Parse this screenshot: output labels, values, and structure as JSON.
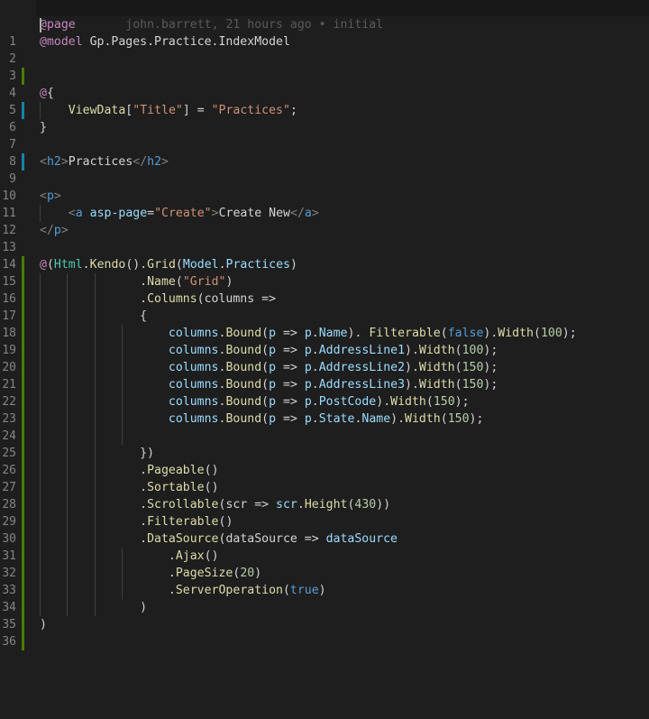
{
  "blame": "john.barrett, 21 hours ago • initial",
  "lines": [
    {
      "n": "1",
      "diff": "none",
      "cursor": true,
      "tokens": [
        [
          "kw",
          "@"
        ],
        [
          "kw",
          "page"
        ]
      ]
    },
    {
      "n": "2",
      "diff": "none",
      "tokens": [
        [
          "kw",
          "@model"
        ],
        [
          "pl",
          " Gp.Pages.Practice.IndexModel"
        ]
      ]
    },
    {
      "n": "3",
      "diff": "none",
      "tokens": []
    },
    {
      "n": "4",
      "diff": "add",
      "tokens": []
    },
    {
      "n": "5",
      "diff": "none",
      "tokens": [
        [
          "kw",
          "@"
        ],
        [
          "pl",
          "{"
        ]
      ]
    },
    {
      "n": "6",
      "diff": "mod",
      "guides": [
        1
      ],
      "tokens": [
        [
          "pl",
          "    "
        ],
        [
          "fn",
          "ViewData"
        ],
        [
          "pl",
          "["
        ],
        [
          "str",
          "\"Title\""
        ],
        [
          "pl",
          "] = "
        ],
        [
          "str",
          "\"Practices\""
        ],
        [
          "pl",
          ";"
        ]
      ]
    },
    {
      "n": "7",
      "diff": "none",
      "tokens": [
        [
          "pl",
          "}"
        ]
      ]
    },
    {
      "n": "8",
      "diff": "none",
      "tokens": []
    },
    {
      "n": "9",
      "diff": "mod",
      "tokens": [
        [
          "tag",
          "<"
        ],
        [
          "tagn",
          "h2"
        ],
        [
          "tag",
          ">"
        ],
        [
          "pl",
          "Practices"
        ],
        [
          "tag",
          "</"
        ],
        [
          "tagn",
          "h2"
        ],
        [
          "tag",
          ">"
        ]
      ]
    },
    {
      "n": "10",
      "diff": "none",
      "tokens": []
    },
    {
      "n": "11",
      "diff": "none",
      "tokens": [
        [
          "tag",
          "<"
        ],
        [
          "tagn",
          "p"
        ],
        [
          "tag",
          ">"
        ]
      ]
    },
    {
      "n": "12",
      "diff": "none",
      "guides": [
        1
      ],
      "tokens": [
        [
          "pl",
          "    "
        ],
        [
          "tag",
          "<"
        ],
        [
          "tagn",
          "a"
        ],
        [
          "pl",
          " "
        ],
        [
          "attr",
          "asp-page"
        ],
        [
          "pl",
          "="
        ],
        [
          "str",
          "\"Create\""
        ],
        [
          "tag",
          ">"
        ],
        [
          "pl",
          "Create New"
        ],
        [
          "tag",
          "</"
        ],
        [
          "tagn",
          "a"
        ],
        [
          "tag",
          ">"
        ]
      ]
    },
    {
      "n": "13",
      "diff": "none",
      "tokens": [
        [
          "tag",
          "</"
        ],
        [
          "tagn",
          "p"
        ],
        [
          "tag",
          ">"
        ]
      ]
    },
    {
      "n": "14",
      "diff": "none",
      "tokens": []
    },
    {
      "n": "15",
      "diff": "add",
      "tokens": [
        [
          "kw",
          "@"
        ],
        [
          "pl",
          "("
        ],
        [
          "ty",
          "Html"
        ],
        [
          "pl",
          "."
        ],
        [
          "fn",
          "Kendo"
        ],
        [
          "pl",
          "()."
        ],
        [
          "fn",
          "Grid"
        ],
        [
          "pl",
          "("
        ],
        [
          "var",
          "Model"
        ],
        [
          "pl",
          "."
        ],
        [
          "var",
          "Practices"
        ],
        [
          "pl",
          ")"
        ]
      ]
    },
    {
      "n": "16",
      "diff": "add",
      "guides": [
        1,
        2,
        3
      ],
      "tokens": [
        [
          "pl",
          "              ."
        ],
        [
          "fn",
          "Name"
        ],
        [
          "pl",
          "("
        ],
        [
          "str",
          "\"Grid\""
        ],
        [
          "pl",
          ")"
        ]
      ]
    },
    {
      "n": "17",
      "diff": "add",
      "guides": [
        1,
        2,
        3
      ],
      "tokens": [
        [
          "pl",
          "              ."
        ],
        [
          "fn",
          "Columns"
        ],
        [
          "pl",
          "(columns =>"
        ]
      ]
    },
    {
      "n": "18",
      "diff": "add",
      "guides": [
        1,
        2,
        3
      ],
      "tokens": [
        [
          "pl",
          "              {"
        ]
      ]
    },
    {
      "n": "19",
      "diff": "add",
      "guides": [
        1,
        2,
        3,
        4
      ],
      "tokens": [
        [
          "pl",
          "                  "
        ],
        [
          "lv",
          "columns"
        ],
        [
          "pl",
          "."
        ],
        [
          "fn",
          "Bound"
        ],
        [
          "pl",
          "("
        ],
        [
          "lv",
          "p"
        ],
        [
          "pl",
          " => "
        ],
        [
          "lv",
          "p"
        ],
        [
          "pl",
          "."
        ],
        [
          "var",
          "Name"
        ],
        [
          "pl",
          "). "
        ],
        [
          "fn",
          "Filterable"
        ],
        [
          "pl",
          "("
        ],
        [
          "bool",
          "false"
        ],
        [
          "pl",
          ")."
        ],
        [
          "fn",
          "Width"
        ],
        [
          "pl",
          "("
        ],
        [
          "num",
          "100"
        ],
        [
          "pl",
          ");"
        ]
      ]
    },
    {
      "n": "20",
      "diff": "add",
      "guides": [
        1,
        2,
        3,
        4
      ],
      "tokens": [
        [
          "pl",
          "                  "
        ],
        [
          "lv",
          "columns"
        ],
        [
          "pl",
          "."
        ],
        [
          "fn",
          "Bound"
        ],
        [
          "pl",
          "("
        ],
        [
          "lv",
          "p"
        ],
        [
          "pl",
          " => "
        ],
        [
          "lv",
          "p"
        ],
        [
          "pl",
          "."
        ],
        [
          "var",
          "AddressLine1"
        ],
        [
          "pl",
          ")."
        ],
        [
          "fn",
          "Width"
        ],
        [
          "pl",
          "("
        ],
        [
          "num",
          "100"
        ],
        [
          "pl",
          ");"
        ]
      ]
    },
    {
      "n": "21",
      "diff": "add",
      "guides": [
        1,
        2,
        3,
        4
      ],
      "tokens": [
        [
          "pl",
          "                  "
        ],
        [
          "lv",
          "columns"
        ],
        [
          "pl",
          "."
        ],
        [
          "fn",
          "Bound"
        ],
        [
          "pl",
          "("
        ],
        [
          "lv",
          "p"
        ],
        [
          "pl",
          " => "
        ],
        [
          "lv",
          "p"
        ],
        [
          "pl",
          "."
        ],
        [
          "var",
          "AddressLine2"
        ],
        [
          "pl",
          ")."
        ],
        [
          "fn",
          "Width"
        ],
        [
          "pl",
          "("
        ],
        [
          "num",
          "150"
        ],
        [
          "pl",
          ");"
        ]
      ]
    },
    {
      "n": "22",
      "diff": "add",
      "guides": [
        1,
        2,
        3,
        4
      ],
      "tokens": [
        [
          "pl",
          "                  "
        ],
        [
          "lv",
          "columns"
        ],
        [
          "pl",
          "."
        ],
        [
          "fn",
          "Bound"
        ],
        [
          "pl",
          "("
        ],
        [
          "lv",
          "p"
        ],
        [
          "pl",
          " => "
        ],
        [
          "lv",
          "p"
        ],
        [
          "pl",
          "."
        ],
        [
          "var",
          "AddressLine3"
        ],
        [
          "pl",
          ")."
        ],
        [
          "fn",
          "Width"
        ],
        [
          "pl",
          "("
        ],
        [
          "num",
          "150"
        ],
        [
          "pl",
          ");"
        ]
      ]
    },
    {
      "n": "23",
      "diff": "add",
      "guides": [
        1,
        2,
        3,
        4
      ],
      "tokens": [
        [
          "pl",
          "                  "
        ],
        [
          "lv",
          "columns"
        ],
        [
          "pl",
          "."
        ],
        [
          "fn",
          "Bound"
        ],
        [
          "pl",
          "("
        ],
        [
          "lv",
          "p"
        ],
        [
          "pl",
          " => "
        ],
        [
          "lv",
          "p"
        ],
        [
          "pl",
          "."
        ],
        [
          "var",
          "PostCode"
        ],
        [
          "pl",
          ")."
        ],
        [
          "fn",
          "Width"
        ],
        [
          "pl",
          "("
        ],
        [
          "num",
          "150"
        ],
        [
          "pl",
          ");"
        ]
      ]
    },
    {
      "n": "24",
      "diff": "add",
      "guides": [
        1,
        2,
        3,
        4
      ],
      "tokens": [
        [
          "pl",
          "                  "
        ],
        [
          "lv",
          "columns"
        ],
        [
          "pl",
          "."
        ],
        [
          "fn",
          "Bound"
        ],
        [
          "pl",
          "("
        ],
        [
          "lv",
          "p"
        ],
        [
          "pl",
          " => "
        ],
        [
          "lv",
          "p"
        ],
        [
          "pl",
          "."
        ],
        [
          "var",
          "State"
        ],
        [
          "pl",
          "."
        ],
        [
          "var",
          "Name"
        ],
        [
          "pl",
          ")."
        ],
        [
          "fn",
          "Width"
        ],
        [
          "pl",
          "("
        ],
        [
          "num",
          "150"
        ],
        [
          "pl",
          ");"
        ]
      ]
    },
    {
      "n": "25",
      "diff": "add",
      "guides": [
        1,
        2,
        3,
        4
      ],
      "tokens": []
    },
    {
      "n": "26",
      "diff": "add",
      "guides": [
        1,
        2,
        3
      ],
      "tokens": [
        [
          "pl",
          "              })"
        ]
      ]
    },
    {
      "n": "27",
      "diff": "add",
      "guides": [
        1,
        2,
        3
      ],
      "tokens": [
        [
          "pl",
          "              ."
        ],
        [
          "fn",
          "Pageable"
        ],
        [
          "pl",
          "()"
        ]
      ]
    },
    {
      "n": "28",
      "diff": "add",
      "guides": [
        1,
        2,
        3
      ],
      "tokens": [
        [
          "pl",
          "              ."
        ],
        [
          "fn",
          "Sortable"
        ],
        [
          "pl",
          "()"
        ]
      ]
    },
    {
      "n": "29",
      "diff": "add",
      "guides": [
        1,
        2,
        3
      ],
      "tokens": [
        [
          "pl",
          "              ."
        ],
        [
          "fn",
          "Scrollable"
        ],
        [
          "pl",
          "(scr => "
        ],
        [
          "lv",
          "scr"
        ],
        [
          "pl",
          "."
        ],
        [
          "fn",
          "Height"
        ],
        [
          "pl",
          "("
        ],
        [
          "num",
          "430"
        ],
        [
          "pl",
          "))"
        ]
      ]
    },
    {
      "n": "30",
      "diff": "add",
      "guides": [
        1,
        2,
        3
      ],
      "tokens": [
        [
          "pl",
          "              ."
        ],
        [
          "fn",
          "Filterable"
        ],
        [
          "pl",
          "()"
        ]
      ]
    },
    {
      "n": "31",
      "diff": "add",
      "guides": [
        1,
        2,
        3
      ],
      "tokens": [
        [
          "pl",
          "              ."
        ],
        [
          "fn",
          "DataSource"
        ],
        [
          "pl",
          "(dataSource => "
        ],
        [
          "lv",
          "dataSource"
        ]
      ]
    },
    {
      "n": "32",
      "diff": "add",
      "guides": [
        1,
        2,
        3,
        4
      ],
      "tokens": [
        [
          "pl",
          "                  ."
        ],
        [
          "fn",
          "Ajax"
        ],
        [
          "pl",
          "()"
        ]
      ]
    },
    {
      "n": "33",
      "diff": "add",
      "guides": [
        1,
        2,
        3,
        4
      ],
      "tokens": [
        [
          "pl",
          "                  ."
        ],
        [
          "fn",
          "PageSize"
        ],
        [
          "pl",
          "("
        ],
        [
          "num",
          "20"
        ],
        [
          "pl",
          ")"
        ]
      ]
    },
    {
      "n": "34",
      "diff": "add",
      "guides": [
        1,
        2,
        3,
        4
      ],
      "tokens": [
        [
          "pl",
          "                  ."
        ],
        [
          "fn",
          "ServerOperation"
        ],
        [
          "pl",
          "("
        ],
        [
          "bool",
          "true"
        ],
        [
          "pl",
          ")"
        ]
      ]
    },
    {
      "n": "35",
      "diff": "add",
      "guides": [
        1,
        2,
        3
      ],
      "tokens": [
        [
          "pl",
          "              )"
        ]
      ]
    },
    {
      "n": "36",
      "diff": "add",
      "tokens": [
        [
          "pl",
          ")"
        ]
      ]
    },
    {
      "n": "",
      "diff": "add",
      "tokens": []
    }
  ]
}
